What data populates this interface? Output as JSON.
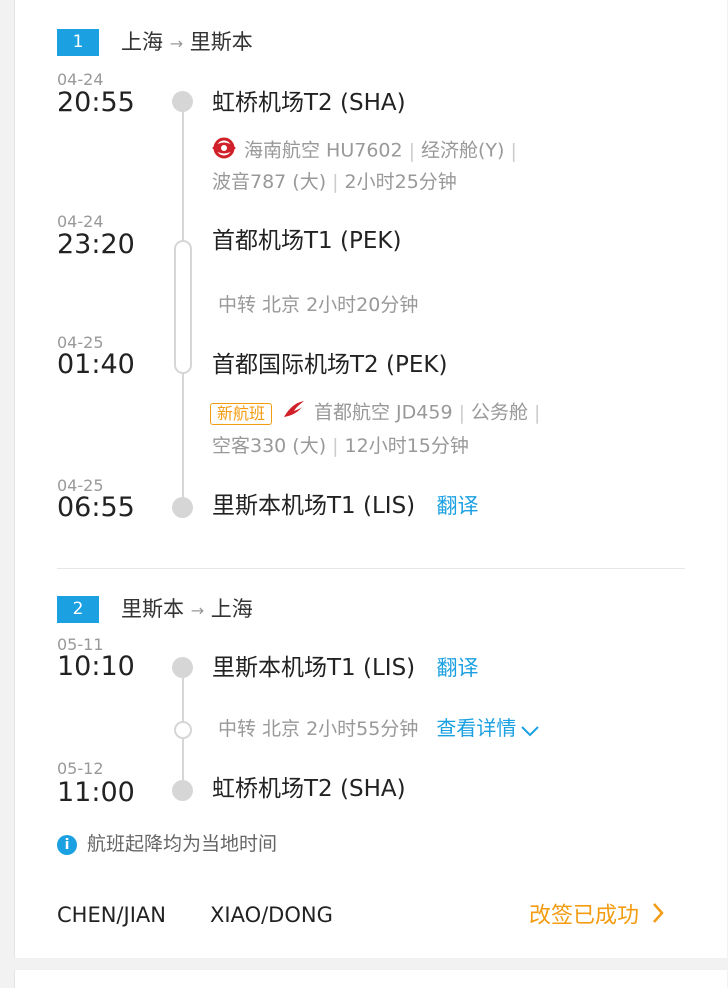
{
  "segments": [
    {
      "index": "1",
      "route_from": "上海",
      "route_arrow": "→",
      "route_to": "里斯本",
      "stops": [
        {
          "date": "04-24",
          "time": "20:55",
          "airport": "虹桥机场T2 (SHA)"
        },
        {
          "date": "04-24",
          "time": "23:20",
          "airport": "首都机场T1 (PEK)"
        },
        {
          "date": "04-25",
          "time": "01:40",
          "airport": "首都国际机场T2 (PEK)"
        },
        {
          "date": "04-25",
          "time": "06:55",
          "airport": "里斯本机场T1 (LIS)",
          "translate": "翻译"
        }
      ],
      "flight1": {
        "airline": "海南航空 HU7602",
        "cabin": "经济舱(Y)",
        "aircraft": "波音787 (大)",
        "duration": "2小时25分钟"
      },
      "transfer": "中转 北京 2小时20分钟",
      "flight2": {
        "tag": "新航班",
        "airline": "首都航空 JD459",
        "cabin": "公务舱",
        "aircraft": "空客330 (大)",
        "duration": "12小时15分钟"
      }
    },
    {
      "index": "2",
      "route_from": "里斯本",
      "route_arrow": "→",
      "route_to": "上海",
      "stops": [
        {
          "date": "05-11",
          "time": "10:10",
          "airport": "里斯本机场T1 (LIS)",
          "translate": "翻译"
        },
        {
          "date": "05-12",
          "time": "11:00",
          "airport": "虹桥机场T2 (SHA)"
        }
      ],
      "transfer": "中转 北京 2小时55分钟",
      "details_link": "查看详情"
    }
  ],
  "note": "航班起降均为当地时间",
  "passengers": [
    "CHEN/JIAN",
    "XIAO/DONG"
  ],
  "status": "改签已成功",
  "colors": {
    "accent": "#1ba0e2",
    "orange": "#f39c12"
  }
}
